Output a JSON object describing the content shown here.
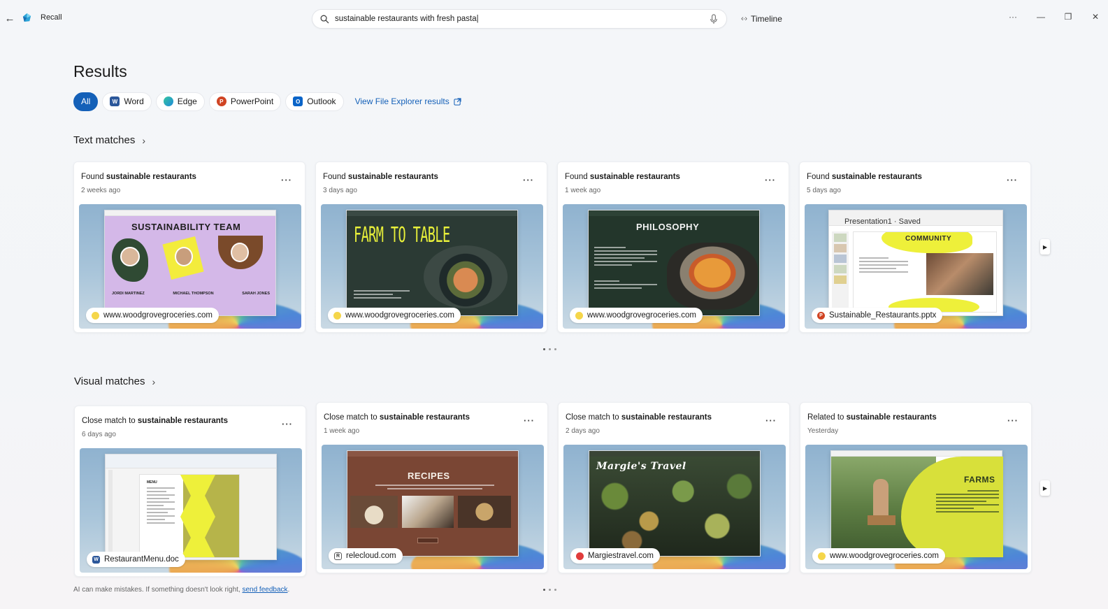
{
  "app": {
    "name": "Recall"
  },
  "search": {
    "value": "sustainable restaurants with fresh pasta|",
    "placeholder": ""
  },
  "toolbar": {
    "timeline_label": "Timeline"
  },
  "results": {
    "title": "Results",
    "filters": [
      {
        "label": "All",
        "active": true
      },
      {
        "label": "Word",
        "icon": "word-icon",
        "color": "#2b579a"
      },
      {
        "label": "Edge",
        "icon": "edge-icon",
        "color": "#1f8ad9"
      },
      {
        "label": "PowerPoint",
        "icon": "powerpoint-icon",
        "color": "#d04423"
      },
      {
        "label": "Outlook",
        "icon": "outlook-icon",
        "color": "#0a64c8"
      }
    ],
    "file_explorer_link": "View File Explorer results"
  },
  "text_matches": {
    "title": "Text matches",
    "cards": [
      {
        "prefix": "Found ",
        "bold": "sustainable restaurants",
        "time": "2 weeks ago",
        "source": "www.woodgrovegroceries.com",
        "source_icon": "edge-icon",
        "slide_title": "SUSTAINABILITY TEAM",
        "people": [
          "JORDI MARTINEZ",
          "MICHAEL THOMPSON",
          "SARAH JONES"
        ]
      },
      {
        "prefix": "Found ",
        "bold": "sustainable restaurants",
        "time": "3 days ago",
        "source": "www.woodgrovegroceries.com",
        "source_icon": "edge-icon",
        "slide_title": "FARM TO TABLE"
      },
      {
        "prefix": "Found ",
        "bold": "sustainable restaurants",
        "time": "1 week ago",
        "source": "www.woodgrovegroceries.com",
        "source_icon": "edge-icon",
        "slide_title": "PHILOSOPHY"
      },
      {
        "prefix": "Found ",
        "bold": "sustainable restaurants",
        "time": "5 days ago",
        "source": "Sustainable_Restaurants.pptx",
        "source_icon": "powerpoint-icon",
        "slide_title": "COMMUNITY",
        "doc_title": "Presentation1 · Saved"
      }
    ]
  },
  "visual_matches": {
    "title": "Visual matches",
    "cards": [
      {
        "prefix": "Close match to ",
        "bold": "sustainable restaurants",
        "time": "6 days ago",
        "source": "RestaurantMenu.doc",
        "source_icon": "word-icon",
        "slide_title": "MENU"
      },
      {
        "prefix": "Close match to ",
        "bold": "sustainable restaurants",
        "time": "1 week ago",
        "source": "relecloud.com",
        "source_icon": "relecloud-icon",
        "slide_title": "RECIPES"
      },
      {
        "prefix": "Close match to ",
        "bold": "sustainable restaurants",
        "time": "2 days ago",
        "source": "Margiestravel.com",
        "source_icon": "margies-icon",
        "slide_title": "Margie's Travel"
      },
      {
        "prefix": "Related to ",
        "bold": "sustainable restaurants",
        "time": "Yesterday",
        "source": "www.woodgrovegroceries.com",
        "source_icon": "edge-icon",
        "slide_title": "FARMS"
      }
    ]
  },
  "footer": {
    "note": "AI can make mistakes. If something doesn't look right,",
    "link": "send feedback",
    "end": "."
  },
  "colors": {
    "accent": "#1460b8"
  }
}
